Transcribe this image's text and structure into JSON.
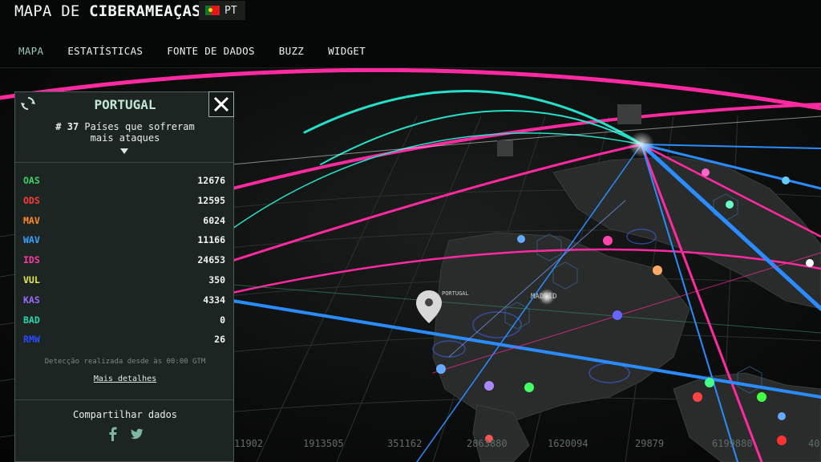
{
  "header": {
    "title_prefix": "MAPA DE ",
    "title_bold": "CIBERAMEAÇAS",
    "lang": {
      "code": "PT",
      "flag": "portugal-flag"
    }
  },
  "nav": {
    "items": [
      "MAPA",
      "ESTATÍSTICAS",
      "FONTE DE DADOS",
      "BUZZ",
      "WIDGET"
    ]
  },
  "panel": {
    "country": "PORTUGAL",
    "rank_number": "# 37",
    "rank_text": "Países que sofreram mais ataques",
    "stats": [
      {
        "label": "OAS",
        "value": "12676",
        "color": "#3fd26a"
      },
      {
        "label": "ODS",
        "value": "12595",
        "color": "#ff3a3a"
      },
      {
        "label": "MAV",
        "value": "6024",
        "color": "#ff8a2a"
      },
      {
        "label": "WAV",
        "value": "11166",
        "color": "#3aa0ff"
      },
      {
        "label": "IDS",
        "value": "24653",
        "color": "#ff3aa8"
      },
      {
        "label": "VUL",
        "value": "350",
        "color": "#e8e84a"
      },
      {
        "label": "KAS",
        "value": "4334",
        "color": "#9a6aff"
      },
      {
        "label": "BAD",
        "value": "0",
        "color": "#2ad6b0"
      },
      {
        "label": "RMW",
        "value": "26",
        "color": "#2a4aff"
      }
    ],
    "detection_note": "Detecção realizada desde às 00:00 GTM",
    "more_details": "Mais detalhes",
    "share_title": "Compartilhar dados",
    "social": [
      "facebook-icon",
      "twitter-icon"
    ]
  },
  "map": {
    "country_labels": [
      "PORTUGAL",
      "MADRID"
    ],
    "bottom_numbers": [
      "11902",
      "1913505",
      "351162",
      "2863880",
      "1620094",
      "29879",
      "6199880",
      "40"
    ]
  }
}
